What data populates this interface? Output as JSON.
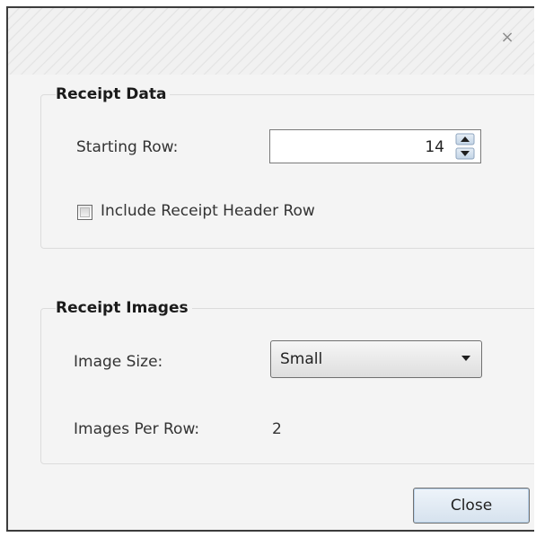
{
  "dialog": {
    "close_glyph": "×"
  },
  "receipt_data": {
    "title": "Receipt Data",
    "starting_row_label": "Starting Row:",
    "starting_row_value": "14",
    "include_header_label": "Include Receipt Header Row",
    "include_header_checked": false
  },
  "receipt_images": {
    "title": "Receipt Images",
    "image_size_label": "Image Size:",
    "image_size_value": "Small",
    "images_per_row_label": "Images Per Row:",
    "images_per_row_value": "2"
  },
  "footer": {
    "close_label": "Close"
  }
}
